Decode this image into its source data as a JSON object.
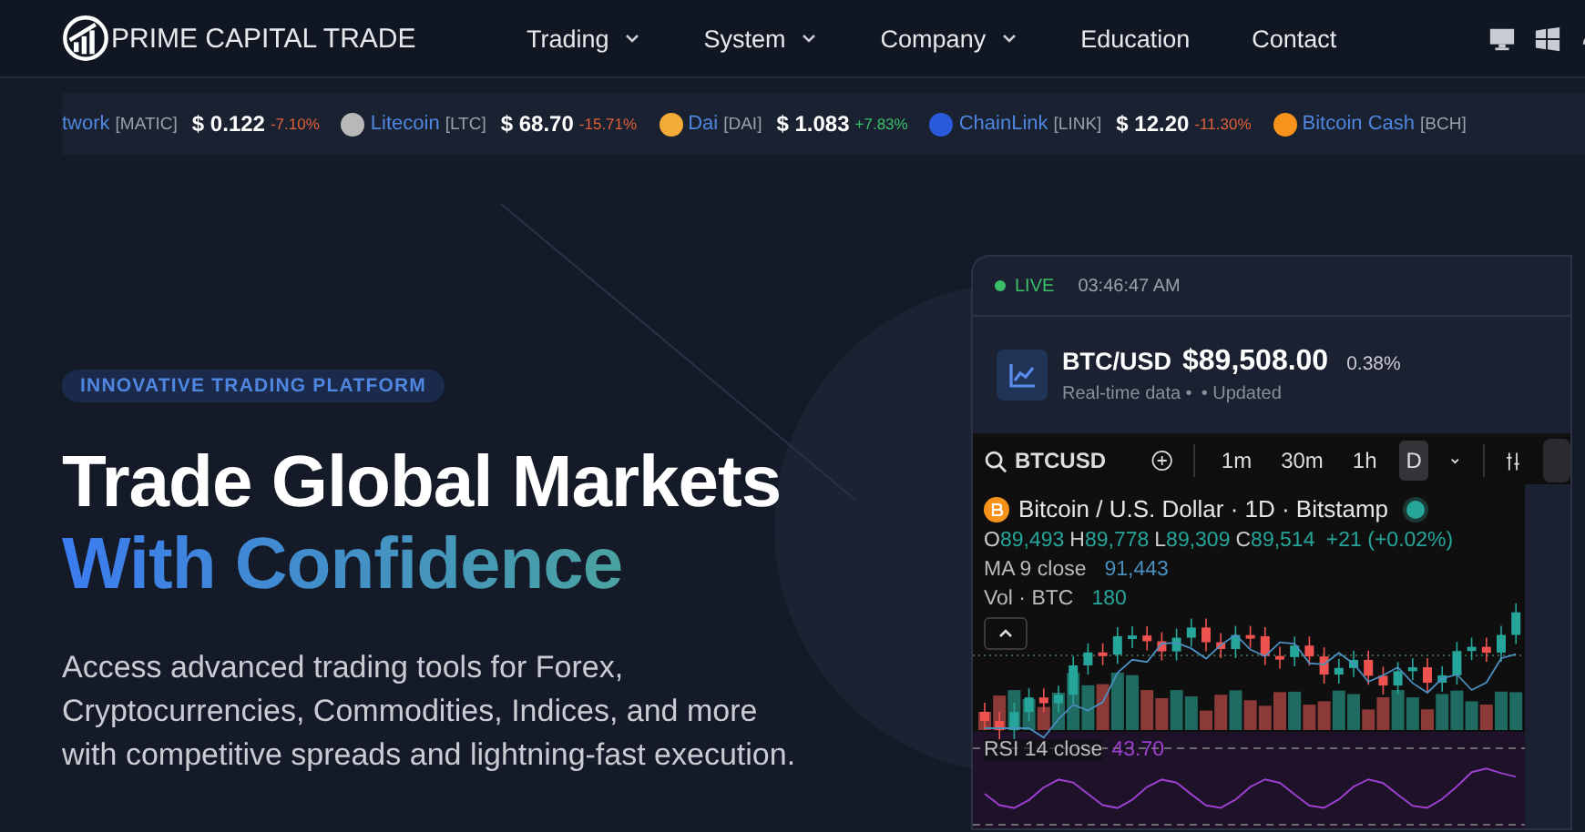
{
  "header": {
    "logo_text": "PRIME CAPITAL TRADE",
    "nav": [
      {
        "label": "Trading",
        "has_menu": true
      },
      {
        "label": "System",
        "has_menu": true
      },
      {
        "label": "Company",
        "has_menu": true
      },
      {
        "label": "Education",
        "has_menu": false
      },
      {
        "label": "Contact",
        "has_menu": false
      }
    ]
  },
  "ticker": [
    {
      "name": "twork",
      "symbol": "[MATIC]",
      "price": "$ 0.122",
      "change": {
        "text": "-7.10%",
        "color": "#e0603a"
      }
    },
    {
      "name": "Litecoin",
      "symbol": "[LTC]",
      "price": "$ 68.70",
      "change": {
        "text": "-15.71%",
        "color": "#e0603a"
      },
      "color": "#b8b8b8"
    },
    {
      "name": "Dai",
      "symbol": "[DAI]",
      "price": "$ 1.083",
      "change": {
        "text": "+7.83%",
        "color": "#3cbf6a"
      },
      "color": "#f5ac37"
    },
    {
      "name": "ChainLink",
      "symbol": "[LINK]",
      "price": "$ 12.20",
      "change": {
        "text": "-11.30%",
        "color": "#e0603a"
      },
      "color": "#2a5ada"
    },
    {
      "name": "Bitcoin Cash",
      "symbol": "[BCH]",
      "color": "#f7931a"
    }
  ],
  "hero": {
    "badge": "INNOVATIVE TRADING PLATFORM",
    "title_line_1": "Trade Global Markets",
    "title_line_2": "With Confidence",
    "description": "Access advanced trading tools for Forex, Cryptocurrencies, Commodities, Indices, and more with competitive spreads and lightning-fast execution."
  },
  "widget": {
    "status": "LIVE",
    "time": "03:46:47 AM",
    "pair": "BTC/USD",
    "price": "$89,508.00",
    "change": "0.38%",
    "subtitle": "Real-time data •",
    "updated": "• Updated",
    "toolbar": {
      "symbol": "BTCUSD",
      "intervals": [
        {
          "label": "1m",
          "selected": false
        },
        {
          "label": "30m",
          "selected": false
        },
        {
          "label": "1h",
          "selected": false
        },
        {
          "label": "D",
          "selected": true
        }
      ]
    },
    "legend": {
      "title": "Bitcoin / U.S. Dollar · 1D · Bitstamp",
      "ohlc": [
        {
          "label": "O",
          "value": "89,493"
        },
        {
          "label": "H",
          "value": "89,778"
        },
        {
          "label": "L",
          "value": "89,309"
        },
        {
          "label": "C",
          "value": "89,514"
        }
      ],
      "change": "+21 (+0.02%)",
      "ma_label": "MA 9 close",
      "ma_value": "91,443",
      "vol_label": "Vol · BTC",
      "vol_value": "180",
      "rsi_label": "RSI 14 close",
      "rsi_value": "43.70"
    }
  }
}
